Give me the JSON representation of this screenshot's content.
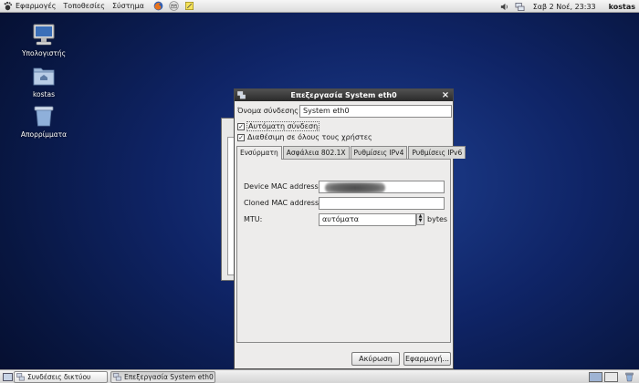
{
  "top_panel": {
    "menus": [
      "Εφαρμογές",
      "Τοποθεσίες",
      "Σύστημα"
    ],
    "launchers": [
      "firefox-icon",
      "mail-icon",
      "notes-icon"
    ],
    "clock": "Σαβ  2 Νοέ, 23:33",
    "user": "kostas"
  },
  "desktop": {
    "icons": [
      {
        "label": "Υπολογιστής",
        "icon": "computer-icon"
      },
      {
        "label": "kostas",
        "icon": "home-folder-icon"
      },
      {
        "label": "Απορρίμματα",
        "icon": "trash-icon"
      }
    ]
  },
  "dialog": {
    "title": "Επεξεργασία System eth0",
    "connection_name_label": "Όνομα σύνδεσης:",
    "connection_name_value": "System eth0",
    "auto_connect": {
      "label": "Αυτόματη σύνδεση",
      "checked": true
    },
    "all_users": {
      "label": "Διαθέσιμη σε όλους τους χρήστες",
      "checked": true
    },
    "tabs": [
      "Ενσύρματη",
      "Ασφάλεια 802.1X",
      "Ρυθμίσεις IPv4",
      "Ρυθμίσεις IPv6"
    ],
    "active_tab": "Ενσύρματη",
    "wired": {
      "device_mac_label": "Device MAC address:",
      "device_mac_value": "",
      "cloned_mac_label": "Cloned MAC address:",
      "cloned_mac_value": "",
      "mtu_label": "MTU:",
      "mtu_value": "αυτόματα",
      "mtu_unit": "bytes"
    },
    "buttons": {
      "cancel": "Ακύρωση",
      "apply": "Εφαρμογή..."
    }
  },
  "taskbar": {
    "tasks": [
      {
        "label": "Συνδέσεις δικτύου",
        "active": false
      },
      {
        "label": "Επεξεργασία System eth0",
        "active": true
      }
    ]
  },
  "colors": {
    "desktop": "#0f2466",
    "titlebar": "#2f2f2f",
    "dialog_bg": "#edeceb"
  }
}
